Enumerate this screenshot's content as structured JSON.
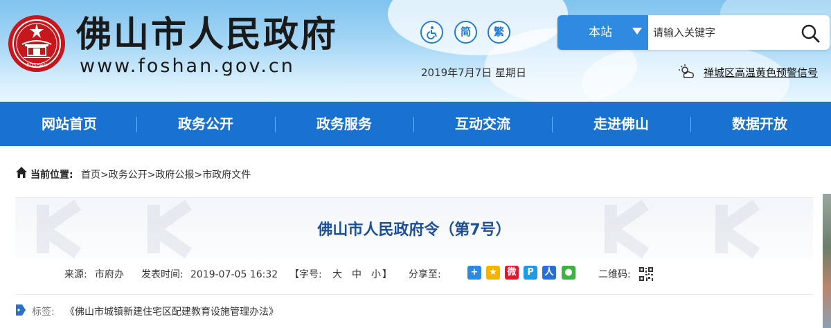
{
  "header": {
    "site_title": "佛山市人民政府",
    "site_url": "www.foshan.gov.cn",
    "logo_text": "FOSHAN",
    "tools": [
      {
        "label": "♿",
        "name": "accessibility"
      },
      {
        "label": "简",
        "name": "simplified"
      },
      {
        "label": "繁",
        "name": "traditional"
      }
    ],
    "date": "2019年7月7日 星期日",
    "search": {
      "scope": "本站",
      "placeholder": "请输入关键字"
    },
    "weather_alert": "禅城区高温黄色预警信号"
  },
  "nav": {
    "items": [
      "网站首页",
      "政务公开",
      "政务服务",
      "互动交流",
      "走进佛山",
      "数据开放"
    ]
  },
  "breadcrumb": {
    "label": "当前位置:",
    "items": [
      "首页",
      "政务公开",
      "政府公报",
      "市政府文件"
    ],
    "separator": ">"
  },
  "article": {
    "title": "佛山市人民政府令（第7号）",
    "source_label": "来源:",
    "source": "市府办",
    "published_label": "发表时间:",
    "published": "2019-07-05 16:32",
    "font_size_label": "【字号:",
    "font_sizes": [
      "大",
      "中",
      "小"
    ],
    "font_size_close": "】",
    "share_label": "分享至:",
    "qr_label": "二维码:",
    "tags_label": "标签:",
    "tag": "《佛山市城镇新建住宅区配建教育设施管理办法》"
  },
  "colors": {
    "nav_bg": "#1a72d0",
    "title_color": "#1c4f96",
    "accent": "#2d8ae0",
    "logo_red": "#c8161d"
  }
}
